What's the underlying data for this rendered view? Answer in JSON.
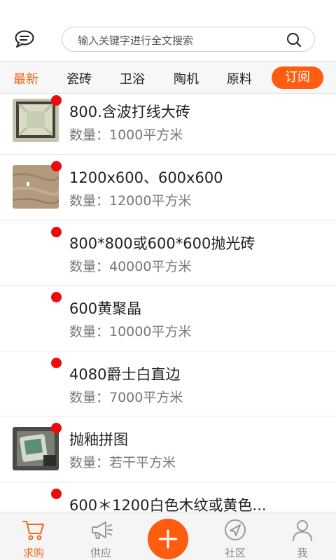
{
  "header": {
    "search_placeholder": "输入关键字进行全文搜索"
  },
  "tabs": [
    {
      "label": "最新",
      "active": true
    },
    {
      "label": "瓷砖",
      "active": false
    },
    {
      "label": "卫浴",
      "active": false
    },
    {
      "label": "陶机",
      "active": false
    },
    {
      "label": "原料",
      "active": false
    }
  ],
  "subscribe_label": "订阅",
  "list": [
    {
      "title": "800.含波打线大砖",
      "qty": "数量：1000平方米",
      "has_image": true
    },
    {
      "title": "1200x600、600x600",
      "qty": "数量：12000平方米",
      "has_image": true
    },
    {
      "title": "800*800或600*600抛光砖",
      "qty": "数量：40000平方米",
      "has_image": false
    },
    {
      "title": "600黄聚晶",
      "qty": "数量：10000平方米",
      "has_image": false
    },
    {
      "title": "4080爵士白直边",
      "qty": "数量：7000平方米",
      "has_image": false
    },
    {
      "title": "抛釉拼图",
      "qty": "数量：若干平方米",
      "has_image": true
    },
    {
      "title": "600＊1200白色木纹或黄色...",
      "qty": "",
      "has_image": false
    }
  ],
  "bottom_nav": [
    {
      "label": "求购",
      "icon": "cart-icon",
      "active": true
    },
    {
      "label": "供应",
      "icon": "megaphone-icon",
      "active": false
    },
    {
      "label": "",
      "icon": "plus-icon",
      "active": false
    },
    {
      "label": "社区",
      "icon": "compass-icon",
      "active": false
    },
    {
      "label": "我",
      "icon": "user-icon",
      "active": false
    }
  ],
  "colors": {
    "accent": "#ff5c10",
    "active_text": "#ef6a1c",
    "unread_dot": "#ee0a0a"
  }
}
